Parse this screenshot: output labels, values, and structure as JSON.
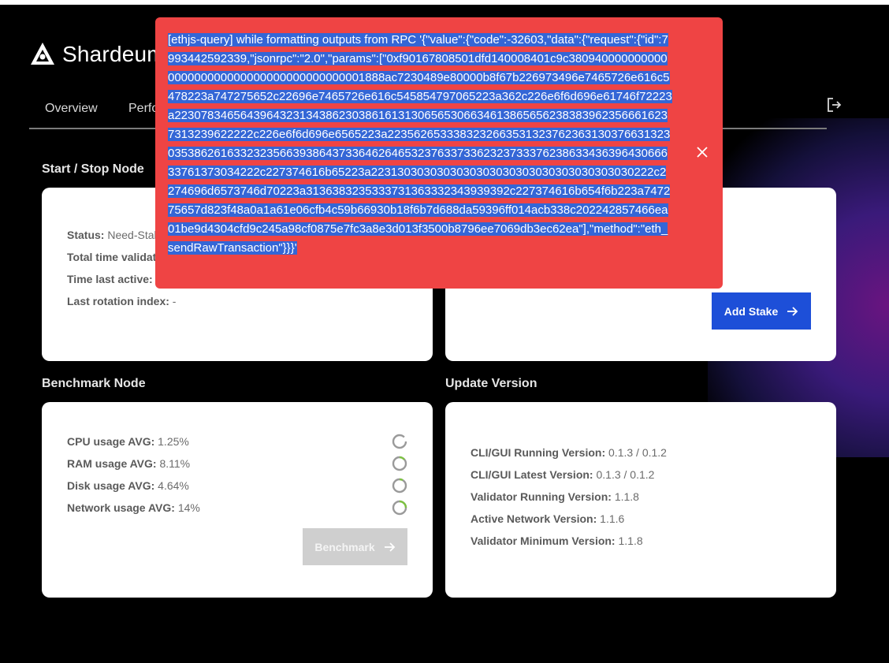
{
  "brand": {
    "name": "Shardeum"
  },
  "nav": {
    "tabs": [
      {
        "label": "Overview"
      },
      {
        "label": "Perfo"
      }
    ],
    "logout_icon": "logout-icon"
  },
  "start_stop": {
    "title": "Start / Stop Node",
    "rows": [
      {
        "key": "Status:",
        "value": "Need-Stak"
      },
      {
        "key": "Total time validati",
        "value": ""
      },
      {
        "key": "Time last active:",
        "value": "-"
      },
      {
        "key": "Last rotation index:",
        "value": "-"
      }
    ]
  },
  "stake": {
    "button_label": "Add Stake"
  },
  "benchmark": {
    "title": "Benchmark Node",
    "rows": [
      {
        "key": "CPU usage AVG:",
        "value": "1.25%"
      },
      {
        "key": "RAM usage AVG:",
        "value": "8.11%"
      },
      {
        "key": "Disk usage AVG:",
        "value": "4.64%"
      },
      {
        "key": "Network usage AVG:",
        "value": "14%"
      }
    ],
    "button_label": "Benchmark"
  },
  "update": {
    "title": "Update Version",
    "rows": [
      {
        "key": "CLI/GUI Running Version:",
        "value": "0.1.3 / 0.1.2"
      },
      {
        "key": "CLI/GUI Latest Version:",
        "value": "0.1.3 / 0.1.2"
      },
      {
        "key": "Validator Running Version:",
        "value": "1.1.8"
      },
      {
        "key": "Active Network Version:",
        "value": "1.1.6"
      },
      {
        "key": "Validator Minimum Version:",
        "value": "1.1.8"
      }
    ]
  },
  "error_toast": {
    "message": "[ethjs-query] while formatting outputs from RPC '{\"value\":{\"code\":-32603,\"data\":{\"request\":{\"id\":7993442592339,\"jsonrpc\":\"2.0\",\"params\":[\"0xf90167808501dfd140008401c9c380940000000000000000000000000000000000000001888ac7230489e80000b8f67b226973496e7465726e616c5478223a747275652c22696e7465726e616c545854797065223a362c226e6f6d696e61746f72223a2230783465643964323134386230386161313065653066346138656562383839623566616237313239622222c226e6f6d696e6565223a2235626533383232663531323762363130376631323035386261633232356639386437336462646532376337336232373337623863343639643066633761373034222c227374616b65223a2231303030303030303030303030303030303030222c2274696d6573746d70223a3136383235333731363332343939392c227374616b654f6b223a747275657d823f48a0a1a61e06cfb4c59b66930b18f6b7d688da59396ff014acb338c202242857466ea01be9d4304cfd9c245a98cf0875e7fc3a8e3d013f3500b8796ee7069db3ec62ea\"],\"method\":\"eth_sendRawTransaction\"}}}'",
    "close_icon": "close-icon"
  }
}
